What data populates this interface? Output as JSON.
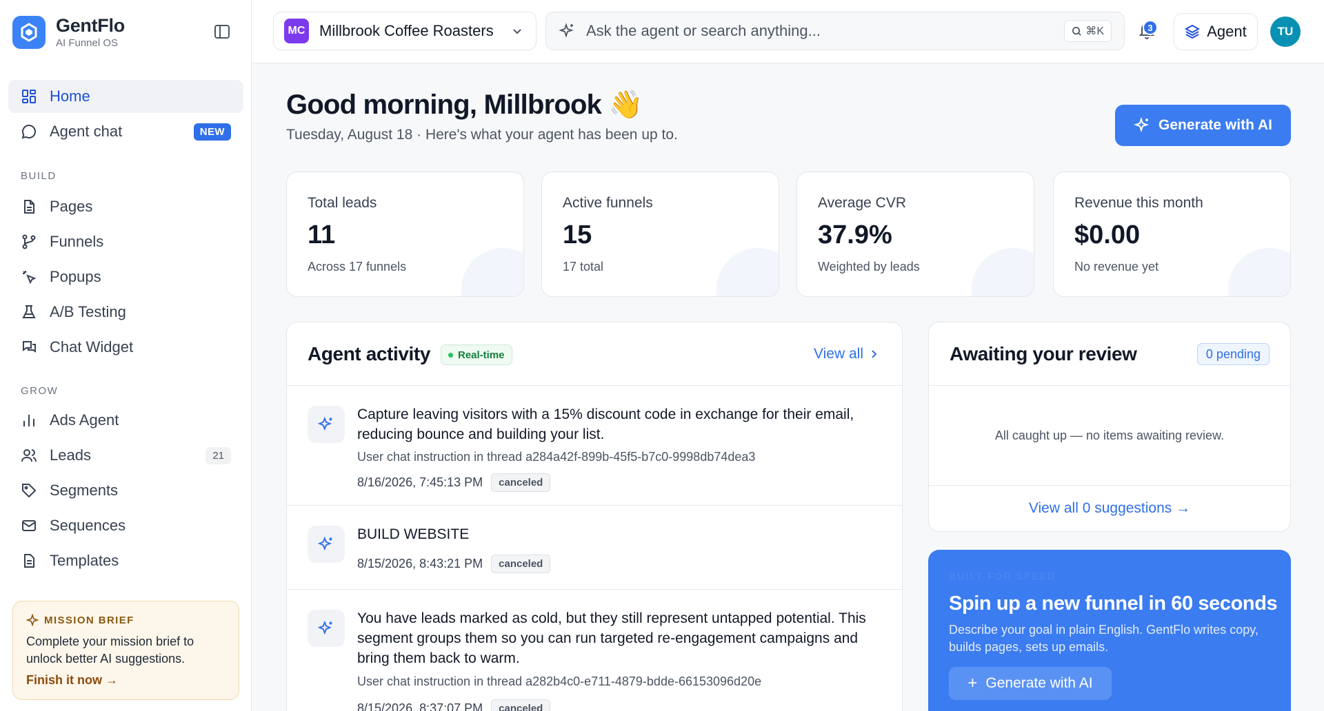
{
  "brand": {
    "name": "GentFlo",
    "subtitle": "AI Funnel OS"
  },
  "sidebar": {
    "items_main": [
      {
        "label": "Home",
        "icon": "grid-icon",
        "active": true
      },
      {
        "label": "Agent chat",
        "icon": "chat-bubble-icon",
        "badge": "NEW"
      }
    ],
    "build_label": "BUILD",
    "build_items": [
      {
        "label": "Pages",
        "icon": "document-icon"
      },
      {
        "label": "Funnels",
        "icon": "branch-icon"
      },
      {
        "label": "Popups",
        "icon": "cursor-click-icon"
      },
      {
        "label": "A/B Testing",
        "icon": "flask-icon"
      },
      {
        "label": "Chat Widget",
        "icon": "chat-widget-icon"
      }
    ],
    "grow_label": "GROW",
    "grow_items": [
      {
        "label": "Ads Agent",
        "icon": "bar-chart-icon"
      },
      {
        "label": "Leads",
        "icon": "users-icon",
        "count": "21"
      },
      {
        "label": "Segments",
        "icon": "tag-icon"
      },
      {
        "label": "Sequences",
        "icon": "mail-icon"
      },
      {
        "label": "Templates",
        "icon": "template-icon"
      }
    ],
    "mission": {
      "title": "MISSION BRIEF",
      "text": "Complete your mission brief to unlock better AI suggestions.",
      "link": "Finish it now →"
    }
  },
  "topbar": {
    "workspace_initials": "MC",
    "workspace_name": "Millbrook Coffee Roasters",
    "search_placeholder": "Ask the agent or search anything...",
    "search_shortcut": "⌘K",
    "notification_count": "3",
    "agent_label": "Agent",
    "user_initials": "TU"
  },
  "main": {
    "greeting": "Good morning, Millbrook",
    "greeting_emoji": "👋",
    "subline": "Tuesday, August 18 · Here's what your agent has been up to.",
    "generate_label": "Generate with AI",
    "stats": [
      {
        "label": "Total leads",
        "value": "11",
        "sub": "Across 17 funnels"
      },
      {
        "label": "Active funnels",
        "value": "15",
        "sub": "17 total"
      },
      {
        "label": "Average CVR",
        "value": "37.9%",
        "sub": "Weighted by leads"
      },
      {
        "label": "Revenue this month",
        "value": "$0.00",
        "sub": "No revenue yet"
      }
    ],
    "activity": {
      "title": "Agent activity",
      "badge": "Real-time",
      "view_all": "View all",
      "items": [
        {
          "text": "Capture leaving visitors with a 15% discount code in exchange for their email, reducing bounce and building your list.",
          "meta": "User chat instruction in thread a284a42f-899b-45f5-b7c0-9998db74dea3",
          "time": "8/16/2026, 7:45:13 PM",
          "status": "canceled"
        },
        {
          "text": "BUILD WEBSITE",
          "meta": "",
          "time": "8/15/2026, 8:43:21 PM",
          "status": "canceled"
        },
        {
          "text": "You have leads marked as cold, but they still represent untapped potential. This segment groups them so you can run targeted re-engagement campaigns and bring them back to warm.",
          "meta": "User chat instruction in thread a282b4c0-e711-4879-bdde-66153096d20e",
          "time": "8/15/2026, 8:37:07 PM",
          "status": "canceled"
        }
      ]
    },
    "review": {
      "title": "Awaiting your review",
      "pending": "0 pending",
      "empty": "All caught up — no items awaiting review.",
      "link": "View all 0 suggestions →"
    },
    "promo": {
      "kicker": "BUILT FOR SPEED",
      "title": "Spin up a new funnel in 60 seconds",
      "text": "Describe your goal in plain English. GentFlo writes copy, builds pages, sets up emails.",
      "button": "Generate with AI"
    }
  },
  "colors": {
    "accent": "#3b7cf0",
    "brand": "#3b82f6",
    "success": "#15803d",
    "workspace": "#7c3aed",
    "avatar": "#0891b2"
  }
}
